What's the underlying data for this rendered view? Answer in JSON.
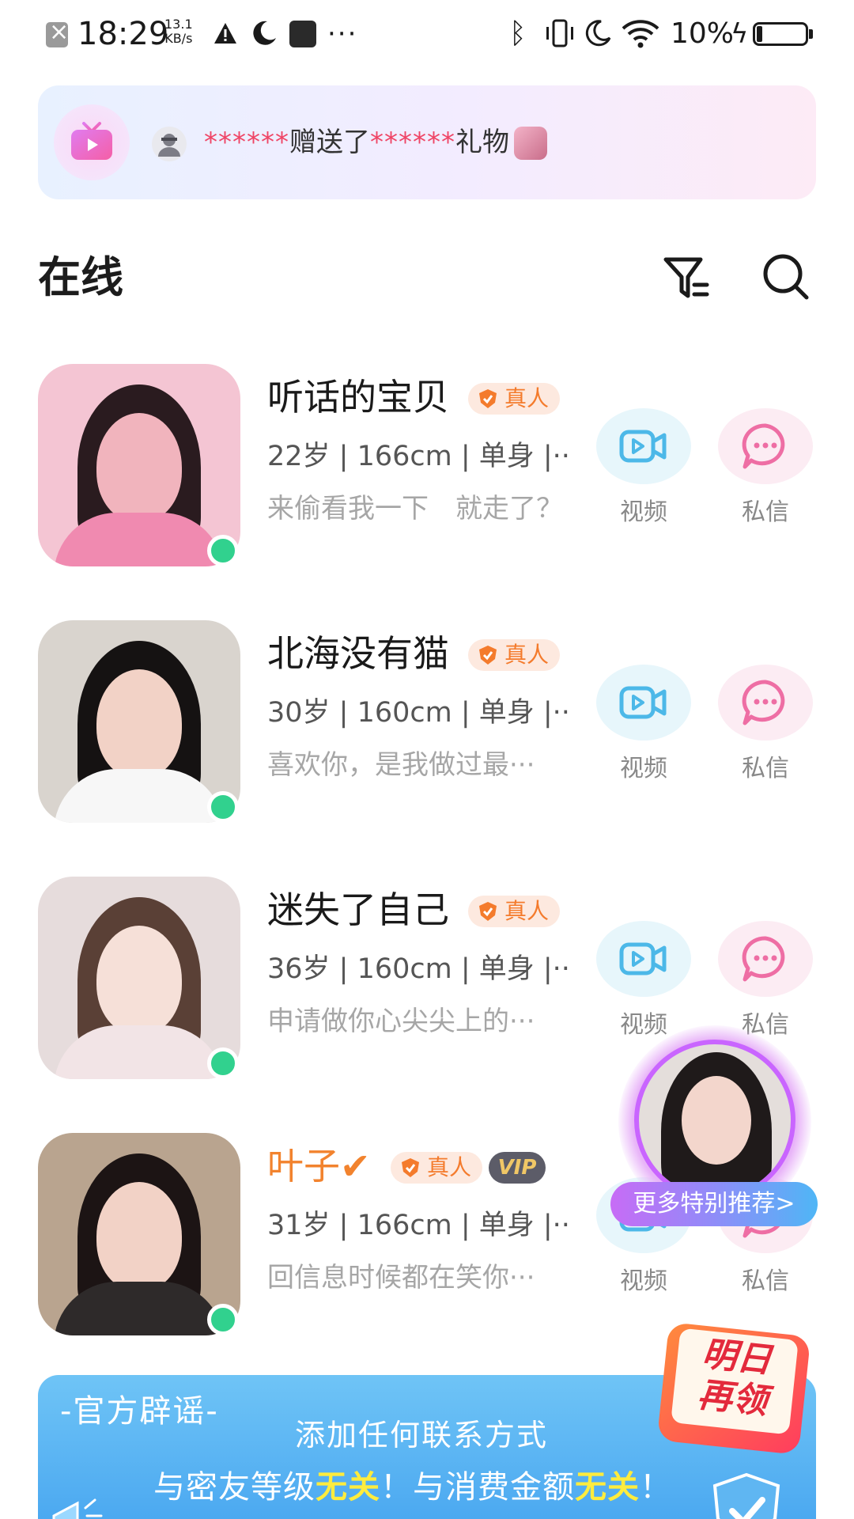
{
  "status_bar": {
    "time": "18:29",
    "net_speed_value": "13.1",
    "net_speed_unit": "KB/s",
    "dots": "···",
    "battery_percent": "10%",
    "bluetooth_glyph": "ᛒ",
    "bolt_glyph": "ϟ"
  },
  "gift_banner": {
    "masked_sender": "******",
    "action_text": "赠送了",
    "masked_receiver": "******",
    "gift_text": "礼物"
  },
  "section": {
    "title": "在线"
  },
  "users": [
    {
      "name": "听话的宝贝",
      "badge": "真人",
      "info": "22岁 | 166cm | 单身 |···",
      "status": "来偷看我一下　就走了？",
      "video_label": "视频",
      "msg_label": "私信",
      "avatar_hair": "#2a1b1f",
      "avatar_body": "#f08ab0",
      "avatar_bg": "#f4c5d3"
    },
    {
      "name": "北海没有猫",
      "badge": "真人",
      "info": "30岁 | 160cm | 单身 |···",
      "status": "喜欢你，是我做过最···",
      "video_label": "视频",
      "msg_label": "私信",
      "avatar_hair": "#151212",
      "avatar_body": "#f7f7f7",
      "avatar_bg": "#d9d4ce"
    },
    {
      "name": "迷失了自己",
      "badge": "真人",
      "info": "36岁 | 160cm | 单身 |···",
      "status": "申请做你心尖尖上的···",
      "video_label": "视频",
      "msg_label": "私信",
      "avatar_hair": "#5a4036",
      "avatar_body": "#f2e4e6",
      "avatar_bg": "#e6dcdc"
    },
    {
      "name": "叶子✔",
      "badge": "真人",
      "vip": "VIP",
      "info": "31岁 | 166cm | 单身 |···",
      "status": "回信息时候都在笑你···",
      "video_label": "视频",
      "msg_label": "私信",
      "avatar_hair": "#1c1414",
      "avatar_body": "#2e2a2a",
      "avatar_bg": "#b9a48f"
    }
  ],
  "floating_recommend": {
    "label": "更多特别推荐>"
  },
  "official_banner": {
    "title": "-官方辟谣-",
    "line1": "添加任何联系方式",
    "line2_a": "与密友等级",
    "line2_hl1": "无关",
    "line2_b": "！与消费金额",
    "line2_hl2": "无关",
    "line2_c": "！"
  },
  "tomorrow_badge": {
    "text": "明日再领"
  },
  "colors": {
    "accent_orange": "#f47b2c",
    "online_green": "#31d18e",
    "video_blue": "#4cb8e8",
    "msg_pink": "#ee6ea4",
    "mask_red": "#ef4566"
  }
}
